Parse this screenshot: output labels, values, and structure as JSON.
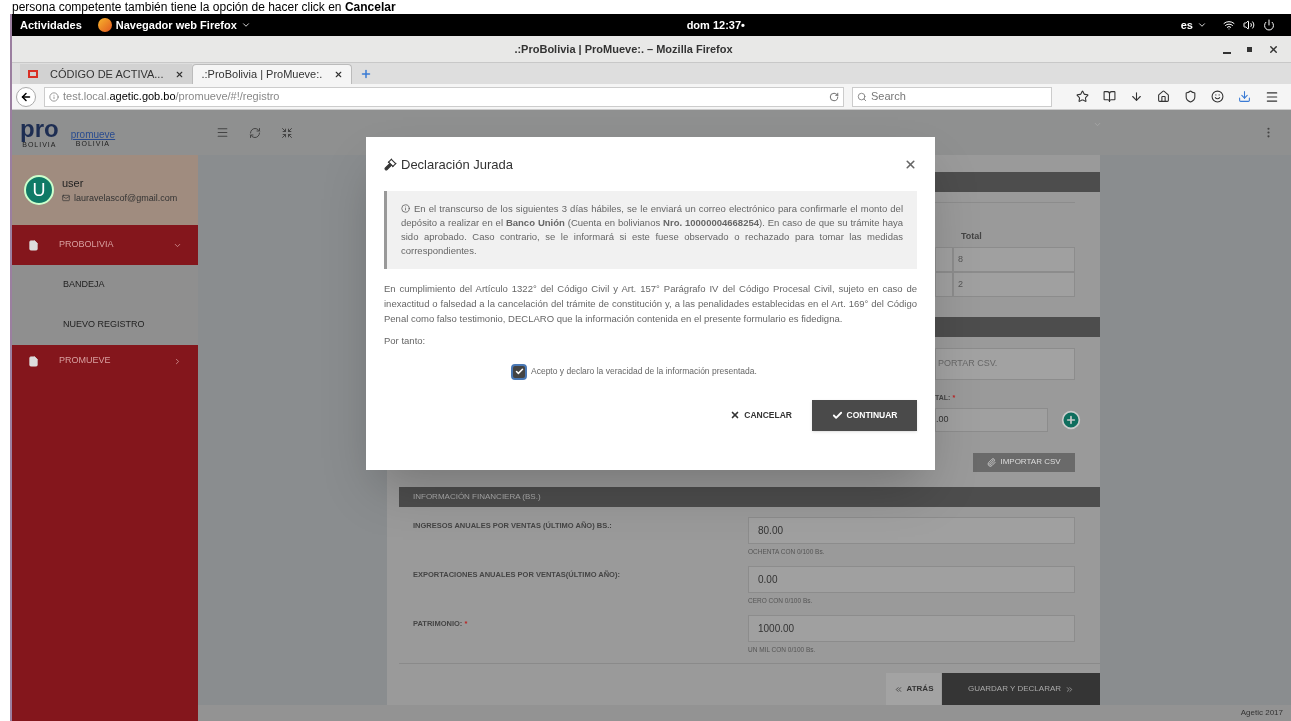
{
  "caption": "persona competente también tiene la opción de hacer click en **Cancelar**",
  "system_bar": {
    "activities": "Actividades",
    "app": "Navegador web Firefox",
    "clock": "dom 12:37•",
    "language": "es"
  },
  "window": {
    "title": ".:ProBolivia | ProMueve:. – Mozilla Firefox"
  },
  "browser_tabs": [
    {
      "label": "CÓDIGO DE ACTIVA...",
      "selected": false
    },
    {
      "label": ".:ProBolivia | ProMueve:.",
      "selected": true
    }
  ],
  "address_bar": {
    "prefix": "test.local.",
    "domain": "agetic.gob.bo",
    "path": "/promueve/#!/registro"
  },
  "search": {
    "placeholder": "Search"
  },
  "logos": [
    {
      "text": "pro",
      "subtext": "BOLIVIA"
    },
    {
      "text": "promueve",
      "subtext": "BOLIVIA"
    }
  ],
  "user": {
    "initial": "U",
    "name": "user",
    "email": "lauravelascof@gmail.com"
  },
  "sidebar": {
    "items": [
      {
        "label": "PROBOLIVIA",
        "expanded": true,
        "children": [
          {
            "label": "BANDEJA"
          },
          {
            "label": "NUEVO REGISTRO"
          }
        ]
      },
      {
        "label": "PROMUEVE",
        "expanded": false
      }
    ]
  },
  "form": {
    "table": {
      "column": "Total",
      "rows": [
        "8",
        "2"
      ]
    },
    "csv_field": "PORTAR CSV.",
    "total_label": "TAL:",
    "total_mark": "*",
    "total_value": ".00",
    "import_button": "IMPORTAR CSV",
    "financial": {
      "title": "INFORMACIÓN FINANCIERA (BS.)",
      "fields": [
        {
          "label": "INGRESOS ANUALES POR VENTAS (ÚLTIMO AÑO) BS.:",
          "value": "80.00",
          "hint": "OCHENTA CON 0/100 Bs."
        },
        {
          "label": "EXPORTACIONES ANUALES POR VENTAS(ÚLTIMO AÑO):",
          "value": "0.00",
          "hint": "CERO CON 0/100 Bs."
        },
        {
          "label": "PATRIMONIO:",
          "mark": "*",
          "value": "1000.00",
          "hint": "UN MIL CON 0/100 Bs."
        }
      ]
    },
    "back_button": "ATRÁS",
    "save_button": "GUARDAR Y DECLARAR"
  },
  "footer": "Agetic 2017",
  "modal": {
    "title": "Declaración Jurada",
    "notice": "En el transcurso de los siguientes 3 días hábiles, se le enviará un correo electrónico para confirmarle el monto del depósito a realizar en el **Banco Unión** (Cuenta en bolivianos **Nro. 10000004668254**). En caso de que su trámite haya sido aprobado. Caso contrario, se le informará si este fuese observado o rechazado para tomar las medidas correspondientes.",
    "body": "En cumplimiento del Artículo 1322° del Código Civil y Art. 157° Parágrafo IV del Código Procesal Civil, sujeto en caso de inexactitud o falsedad a la cancelación del trámite de constitución y, a las penalidades establecidas en el Art. 169° del Código Penal como falso testimonio, DECLARO que la información contenida en el presente formulario es fidedigna.",
    "conclusion": "Por tanto:",
    "agreement": {
      "label": "Acepto y declaro la veracidad de la información presentada.",
      "checked": true
    },
    "cancel": "CANCELAR",
    "continue": "CONTINUAR"
  }
}
